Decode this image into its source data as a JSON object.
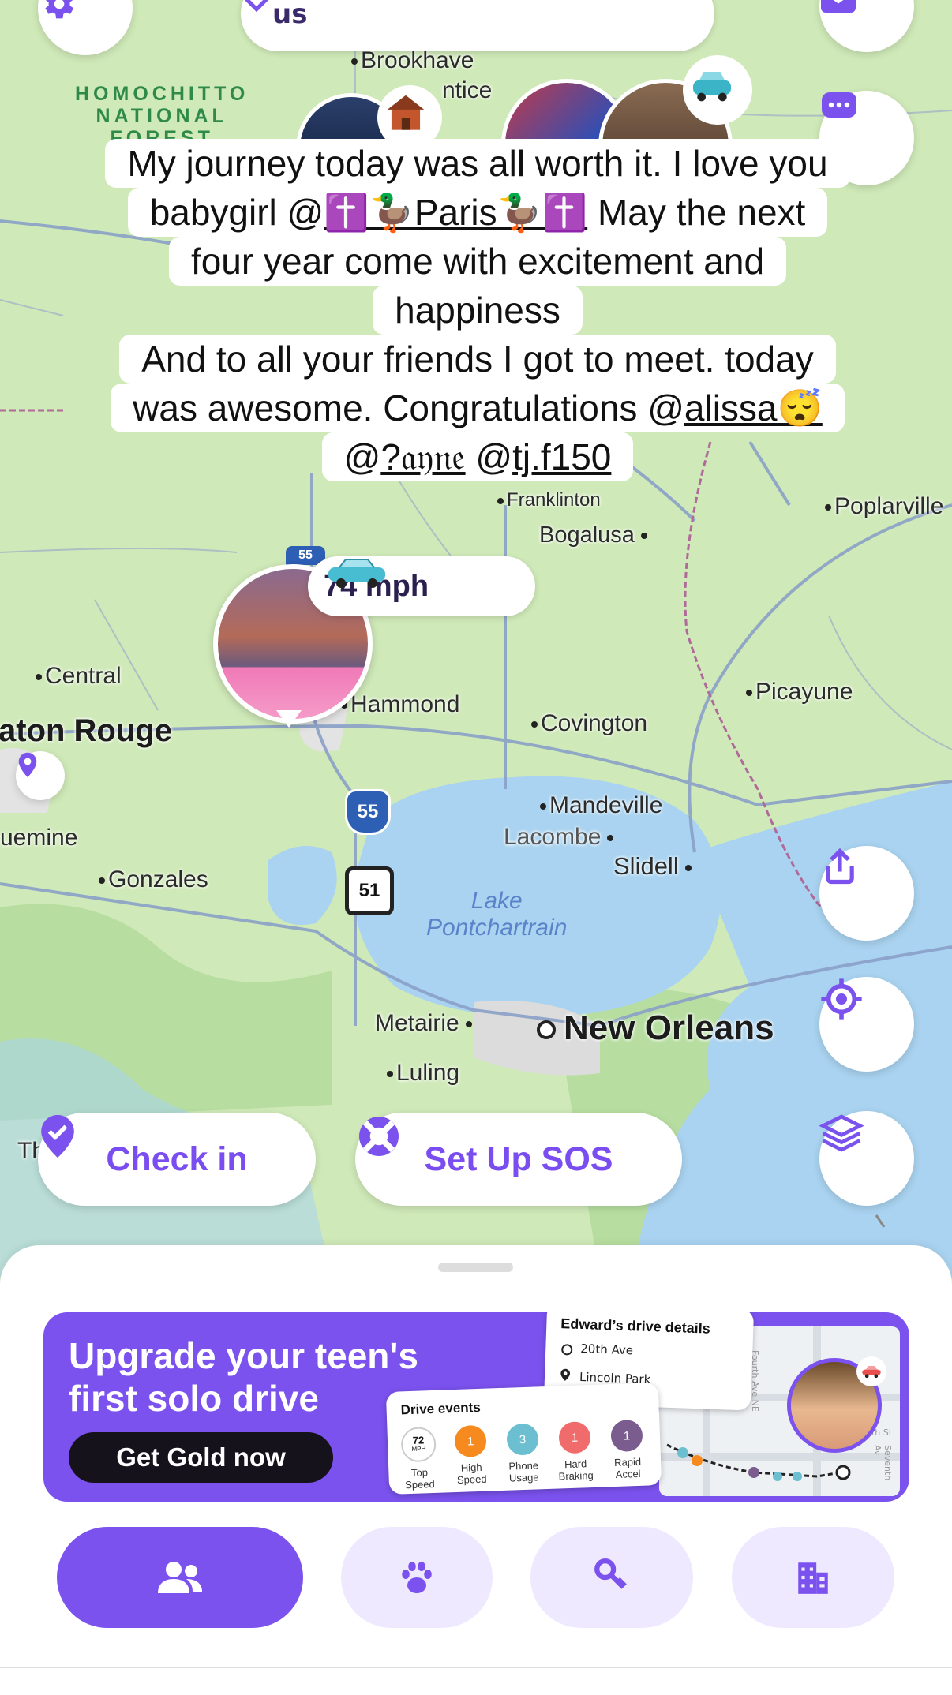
{
  "header": {
    "title": "us"
  },
  "map": {
    "forest_label": "HOMOCHITTO\nNATIONAL\nFOREST",
    "places": {
      "brookhaven": "Brookhave",
      "antice": "ntice",
      "bogalusa": "Bogalusa",
      "poplarville": "Poplarville",
      "central": "Central",
      "baton_rouge": "aton Rouge",
      "hammond": "Hammond",
      "covington": "Covington",
      "picayune": "Picayune",
      "mandeville": "Mandeville",
      "lacombe": "Lacombe",
      "slidell": "Slidell",
      "plaquemine": "uemine",
      "gonzales": "Gonzales",
      "metairie": "Metairie",
      "new_orleans": "New Orleans",
      "luling": "Luling",
      "franklinton": "Franklinton",
      "th": "Th"
    },
    "lake_label": "Lake\nPontchartrain",
    "shields": {
      "interstate": "55",
      "us_route": "51",
      "interstate_top": "55"
    }
  },
  "message": {
    "line1": "My journey today was all worth it. I love you",
    "line2_pre": "babygirl @",
    "line2_mention": "✝️🦆Paris🦆✝️",
    "line2_post": " May the next",
    "line3": "four year come with excitement and",
    "line4": "happiness",
    "line5": "And to all your friends I got to meet. today",
    "line6_pre": "was awesome. Congratulations @",
    "line6_mention": "alissa😴",
    "line7_pre": "@",
    "line7_mention1": "?𝔞𝔶𝔫𝔢",
    "line7_mid": " @",
    "line7_mention2": "tj.f150"
  },
  "speed_badge": {
    "value": "74 mph"
  },
  "actions": {
    "check_in": "Check in",
    "sos": "Set Up SOS"
  },
  "banner": {
    "title_line1": "Upgrade your teen's",
    "title_line2": "first solo drive",
    "cta": "Get Gold now",
    "drive_details": {
      "title": "Edward’s drive details",
      "from": "20th Ave",
      "to": "Lincoln Park",
      "street1": "Fourth Ave NE",
      "street2": "5th St",
      "street3": "Seventh Av"
    },
    "drive_events": {
      "title": "Drive events",
      "items": [
        {
          "value": "72",
          "unit": "MPH",
          "label": "Top\nSpeed",
          "color": "#ffffff"
        },
        {
          "value": "1",
          "label": "High\nSpeed",
          "color": "#f68a1e"
        },
        {
          "value": "3",
          "label": "Phone\nUsage",
          "color": "#6bbfd0"
        },
        {
          "value": "1",
          "label": "Hard\nBraking",
          "color": "#f06b6b"
        },
        {
          "value": "1",
          "label": "Rapid\nAccel",
          "color": "#7a5c8f"
        }
      ]
    }
  },
  "tabs": [
    {
      "name": "people",
      "icon": "people-icon",
      "active": true
    },
    {
      "name": "pets",
      "icon": "paw-icon",
      "active": false
    },
    {
      "name": "items",
      "icon": "keys-icon",
      "active": false
    },
    {
      "name": "places",
      "icon": "building-icon",
      "active": false
    }
  ],
  "colors": {
    "accent": "#7b52ee",
    "map_land": "#cfe9b8",
    "map_water": "#a9d3f0"
  }
}
